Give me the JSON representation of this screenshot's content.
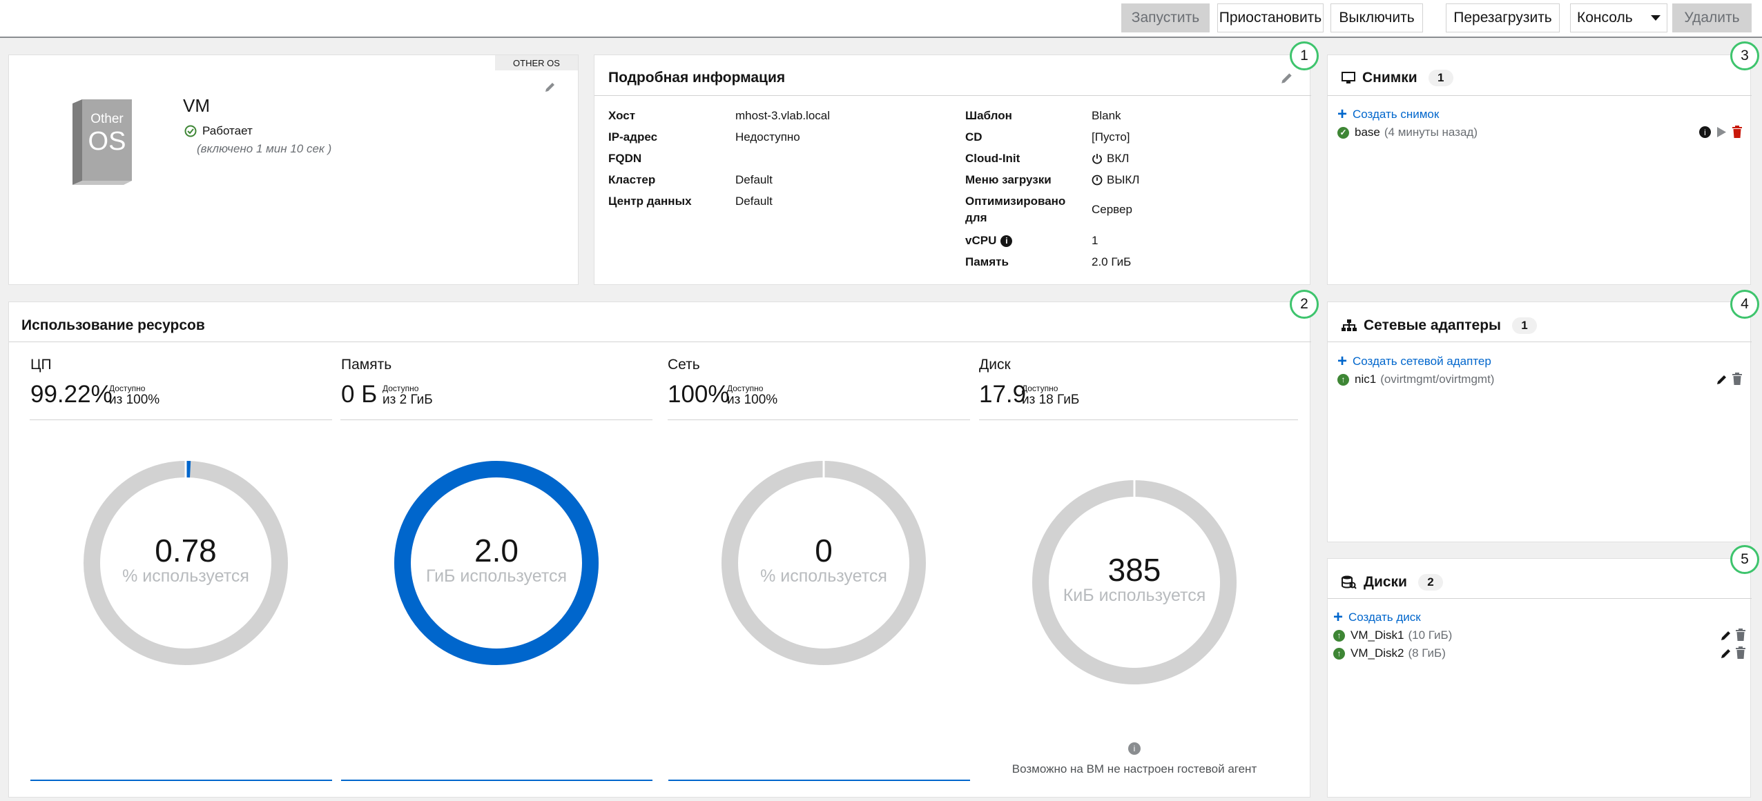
{
  "toolbar": {
    "run": "Запустить",
    "suspend": "Приостановить",
    "shutdown": "Выключить",
    "reboot": "Перезагрузить",
    "console": "Консоль",
    "remove": "Удалить"
  },
  "vm_card": {
    "os_tag": "OTHER OS",
    "os_box_line1": "Other",
    "os_box_line2": "OS",
    "name": "VM",
    "status": "Работает",
    "uptime": "(включено 1 мин 10 сек )"
  },
  "details": {
    "number": "1",
    "title": "Подробная информация",
    "left": [
      {
        "label": "Хост",
        "value": "mhost-3.vlab.local"
      },
      {
        "label": "IP-адрес",
        "value": "Недоступно"
      },
      {
        "label": "FQDN",
        "value": ""
      },
      {
        "label": "Кластер",
        "value": "Default"
      },
      {
        "label": "Центр данных",
        "value": "Default"
      }
    ],
    "right": [
      {
        "label": "Шаблон",
        "value": "Blank"
      },
      {
        "label": "CD",
        "value": "[Пусто]"
      },
      {
        "label": "Cloud-Init",
        "value": "ВКЛ"
      },
      {
        "label": "Меню загрузки",
        "value": "ВЫКЛ"
      },
      {
        "label": "Оптимизировано для",
        "value": "Сервер"
      },
      {
        "label": "vCPU",
        "value": "1"
      },
      {
        "label": "Память",
        "value": "2.0 ГиБ"
      }
    ]
  },
  "snapshots": {
    "number": "3",
    "title": "Снимки",
    "count": "1",
    "create": "Создать снимок",
    "items": [
      {
        "name": "base",
        "meta": "(4 минуты назад)"
      }
    ]
  },
  "nics": {
    "number": "4",
    "title": "Сетевые адаптеры",
    "count": "1",
    "create": "Создать сетевой адаптер",
    "items": [
      {
        "name": "nic1",
        "meta": "(ovirtmgmt/ovirtmgmt)"
      }
    ]
  },
  "disks": {
    "number": "5",
    "title": "Диски",
    "count": "2",
    "create": "Создать диск",
    "items": [
      {
        "name": "VM_Disk1",
        "meta": "(10 ГиБ)"
      },
      {
        "name": "VM_Disk2",
        "meta": "(8 ГиБ)"
      }
    ]
  },
  "utilization": {
    "number": "2",
    "title": "Использование ресурсов",
    "available_label": "Доступно",
    "cpu": {
      "title": "ЦП",
      "big": "99.22%",
      "of": "из 100%",
      "donut_value": "0.78",
      "donut_unit": "% используется",
      "used_fraction": 0.0078
    },
    "memory": {
      "title": "Память",
      "big": "0 Б",
      "of": "из 2 ГиБ",
      "donut_value": "2.0",
      "donut_unit": "ГиБ используется",
      "used_fraction": 1.0
    },
    "network": {
      "title": "Сеть",
      "big": "100%",
      "of": "из 100%",
      "donut_value": "0",
      "donut_unit": "% используется",
      "used_fraction": 0.0
    },
    "disk": {
      "title": "Диск",
      "big": "17.9",
      "of": "из 18 ГиБ",
      "donut_value": "385",
      "donut_unit": "КиБ используется",
      "used_fraction": 0.0
    },
    "agent_note": "Возможно на ВМ не настроен гостевой агент"
  },
  "colors": {
    "accent": "#0066cc",
    "ok": "#3e8635",
    "track": "#d2d2d2",
    "danger": "#c9190b"
  }
}
